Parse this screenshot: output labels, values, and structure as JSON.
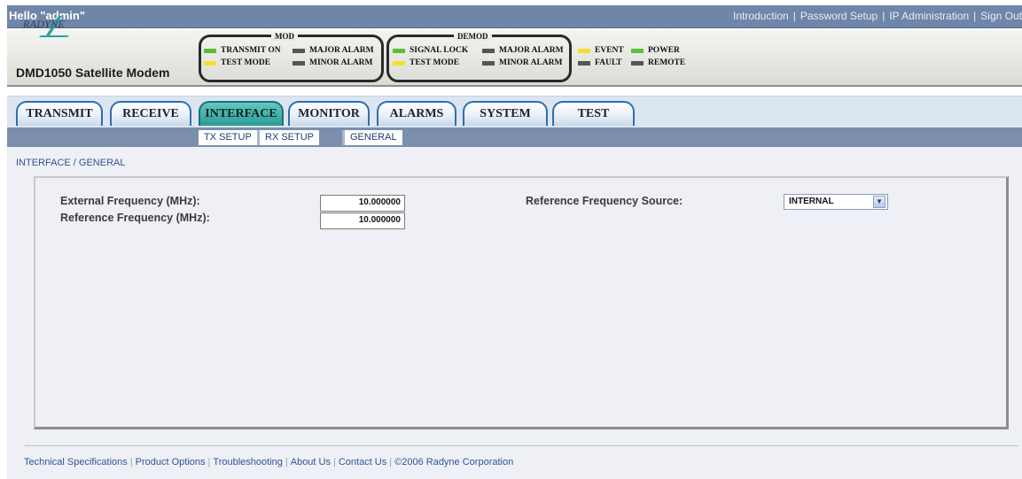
{
  "top": {
    "greeting": "Hello \"admin\"",
    "links": [
      "Introduction",
      "Password Setup",
      "IP Administration",
      "Sign Out"
    ],
    "separator": "|"
  },
  "header": {
    "logo_text": "RADYNE",
    "model": "DMD1050 Satellite Modem",
    "mod": {
      "title": "MOD",
      "leds": [
        {
          "label": "TRANSMIT ON",
          "color": "#5bbf3a"
        },
        {
          "label": "TEST MODE",
          "color": "#f3df2e"
        },
        {
          "label": "MAJOR ALARM",
          "color": "#555555"
        },
        {
          "label": "MINOR ALARM",
          "color": "#555555"
        }
      ]
    },
    "demod": {
      "title": "DEMOD",
      "leds": [
        {
          "label": "SIGNAL LOCK",
          "color": "#5bbf3a"
        },
        {
          "label": "TEST MODE",
          "color": "#f3df2e"
        },
        {
          "label": "MAJOR ALARM",
          "color": "#555555"
        },
        {
          "label": "MINOR ALARM",
          "color": "#555555"
        }
      ]
    },
    "general_leds": [
      {
        "label": "EVENT",
        "color": "#f3df2e"
      },
      {
        "label": "FAULT",
        "color": "#555555"
      },
      {
        "label": "POWER",
        "color": "#5bbf3a"
      },
      {
        "label": "REMOTE",
        "color": "#555555"
      }
    ]
  },
  "tabs": [
    "TRANSMIT",
    "RECEIVE",
    "INTERFACE",
    "MONITOR",
    "ALARMS",
    "SYSTEM",
    "TEST"
  ],
  "active_tab": "INTERFACE",
  "subtabs": [
    "TX SETUP",
    "RX SETUP",
    "GENERAL"
  ],
  "active_subtab": "GENERAL",
  "breadcrumb": "INTERFACE / GENERAL",
  "form": {
    "ext_freq_label": "External Frequency (MHz):",
    "ext_freq_value": "10.000000",
    "ref_freq_label": "Reference Frequency (MHz):",
    "ref_freq_value": "10.000000",
    "ref_source_label": "Reference Frequency Source:",
    "ref_source_value": "INTERNAL"
  },
  "footer": {
    "links": [
      "Technical Specifications",
      "Product Options",
      "Troubleshooting",
      "About Us",
      "Contact Us",
      "©2006 Radyne Corporation"
    ],
    "separator": "|"
  },
  "colors": {
    "led_green": "#5bbf3a",
    "led_yellow": "#f3df2e",
    "led_off": "#555555",
    "active_tab": "#2c9c95",
    "tab_border": "#2d6fb0",
    "link_blue": "#2f5496"
  }
}
